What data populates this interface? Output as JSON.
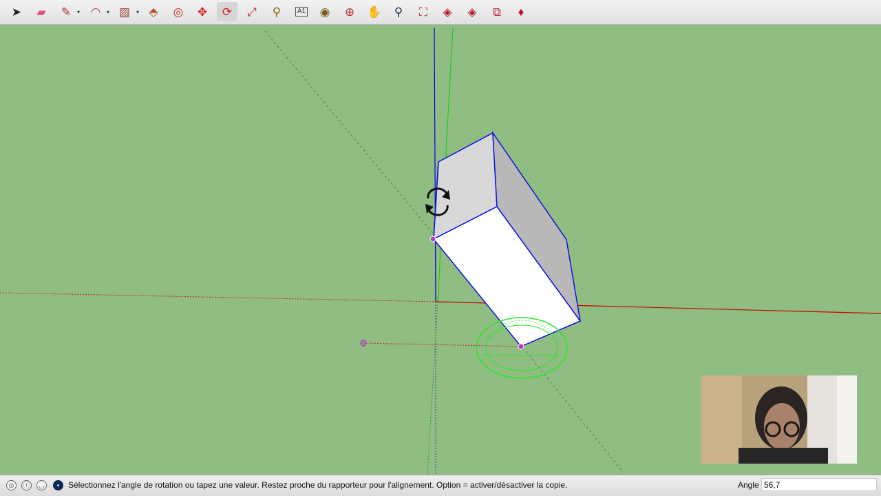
{
  "toolbar": {
    "tools": [
      {
        "name": "select-tool",
        "glyph": "➤",
        "color": "#222222"
      },
      {
        "name": "eraser-tool",
        "glyph": "▰",
        "color": "#e0507a"
      },
      {
        "name": "line-tool",
        "glyph": "✎",
        "color": "#b0302a"
      },
      {
        "name": "arc-tool",
        "glyph": "◠",
        "color": "#c0303a"
      },
      {
        "name": "rectangle-tool",
        "glyph": "▨",
        "color": "#a04040"
      },
      {
        "name": "push-pull-tool",
        "glyph": "⬘",
        "color": "#c04a2a"
      },
      {
        "name": "offset-tool",
        "glyph": "◎",
        "color": "#c02a2a"
      },
      {
        "name": "move-tool",
        "glyph": "✥",
        "color": "#d02020"
      },
      {
        "name": "rotate-tool",
        "glyph": "⟳",
        "color": "#d02020"
      },
      {
        "name": "scale-tool",
        "glyph": "⤢",
        "color": "#c03020"
      },
      {
        "name": "tape-measure-tool",
        "glyph": "⚲",
        "color": "#8a6a10"
      },
      {
        "name": "text-tool",
        "glyph": "A1",
        "color": "#333333"
      },
      {
        "name": "paint-bucket-tool",
        "glyph": "◉",
        "color": "#7a5a1a"
      },
      {
        "name": "orbit-tool",
        "glyph": "⊕",
        "color": "#b03030"
      },
      {
        "name": "pan-tool",
        "glyph": "✋",
        "color": "#c8a040"
      },
      {
        "name": "zoom-tool",
        "glyph": "⚲",
        "color": "#203050"
      },
      {
        "name": "zoom-extents-tool",
        "glyph": "⛶",
        "color": "#c03030"
      },
      {
        "name": "warehouse-tool",
        "glyph": "◈",
        "color": "#b02030"
      },
      {
        "name": "extension-warehouse-tool",
        "glyph": "◈",
        "color": "#b02030"
      },
      {
        "name": "send-to-layout-tool",
        "glyph": "⧉",
        "color": "#c03050"
      },
      {
        "name": "ruby-console-tool",
        "glyph": "♦",
        "color": "#c01020"
      }
    ]
  },
  "status": {
    "message": "Sélectionnez l'angle de rotation ou tapez une valeur.  Restez proche du rapporteur pour l'alignement. Option = activer/désactiver la copie.",
    "measurement_label": "Angle",
    "measurement_value": "56,7"
  },
  "scene": {
    "background": "#8fbd82",
    "x_axis_color": "#cc0000",
    "y_axis_color": "#1ecc1e",
    "z_axis_color": "#0000dd",
    "edge_color": "#1010e0",
    "protractor_color": "#22ee22",
    "inference_color": "#b040b0"
  }
}
